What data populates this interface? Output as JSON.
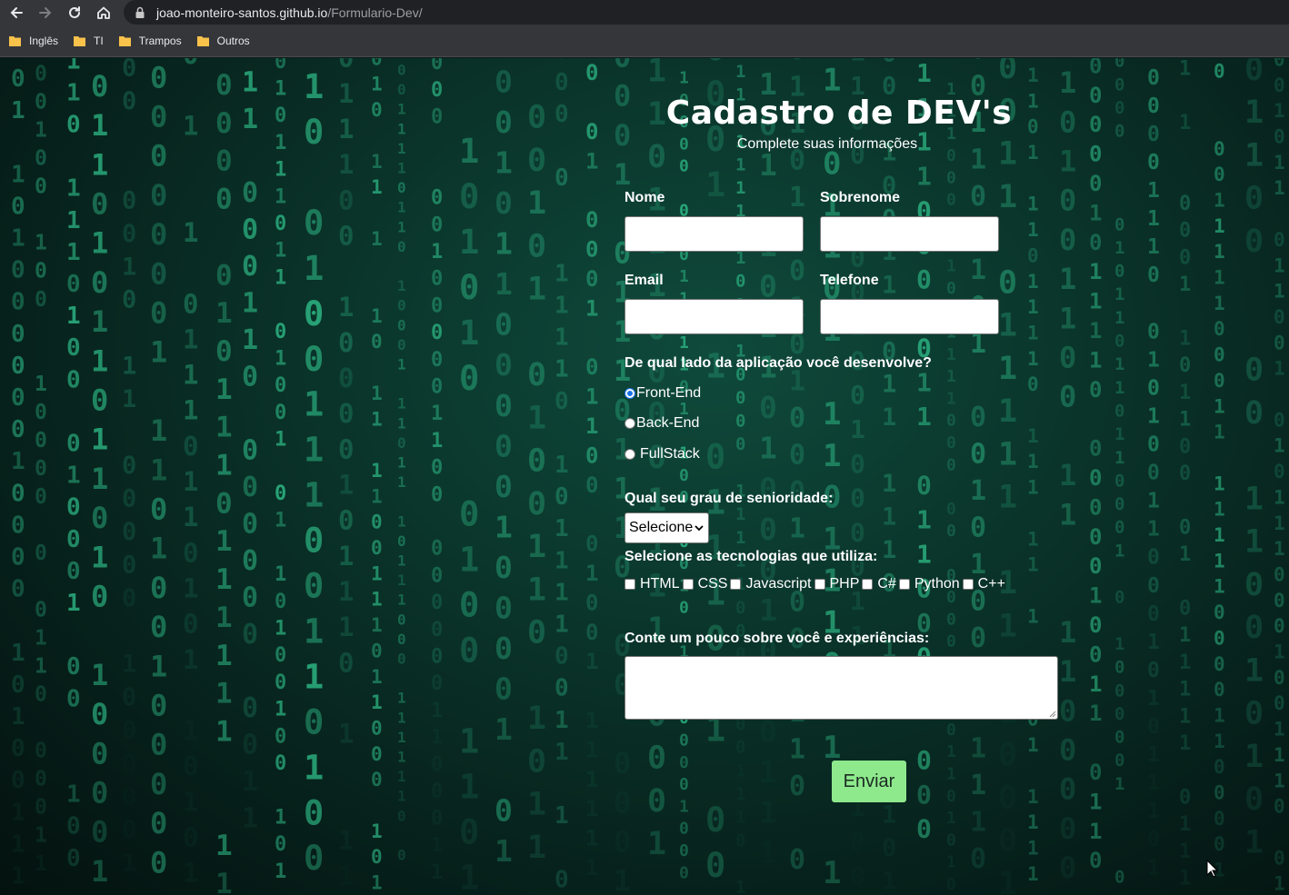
{
  "browser": {
    "url_host": "joao-monteiro-santos.github.io",
    "url_path": "/Formulario-Dev/",
    "bookmarks": [
      "Inglês",
      "TI",
      "Trampos",
      "Outros"
    ]
  },
  "form": {
    "title": "Cadastro de DEV's",
    "subtitle": "Complete suas informações",
    "nome_label": "Nome",
    "sobrenome_label": "Sobrenome",
    "email_label": "Email",
    "telefone_label": "Telefone",
    "side_question": "De qual lado da aplicação você desenvolve?",
    "side_options": [
      "Front-End",
      "Back-End",
      "FullStack"
    ],
    "side_selected": "Front-End",
    "seniority_question": "Qual seu grau de senioridade:",
    "seniority_selected": "Selecione",
    "tech_question": "Selecione as tecnologias que utiliza:",
    "techs": [
      "HTML",
      "CSS",
      "Javascript",
      "PHP",
      "C#",
      "Python",
      "C++"
    ],
    "about_question": "Conte um pouco sobre você e experiências:",
    "submit_label": "Enviar"
  },
  "colors": {
    "background": "#0a3329",
    "glyph": "#2fbf8a",
    "submit": "#8ee98c",
    "radio_selected": "#1a73e8"
  }
}
